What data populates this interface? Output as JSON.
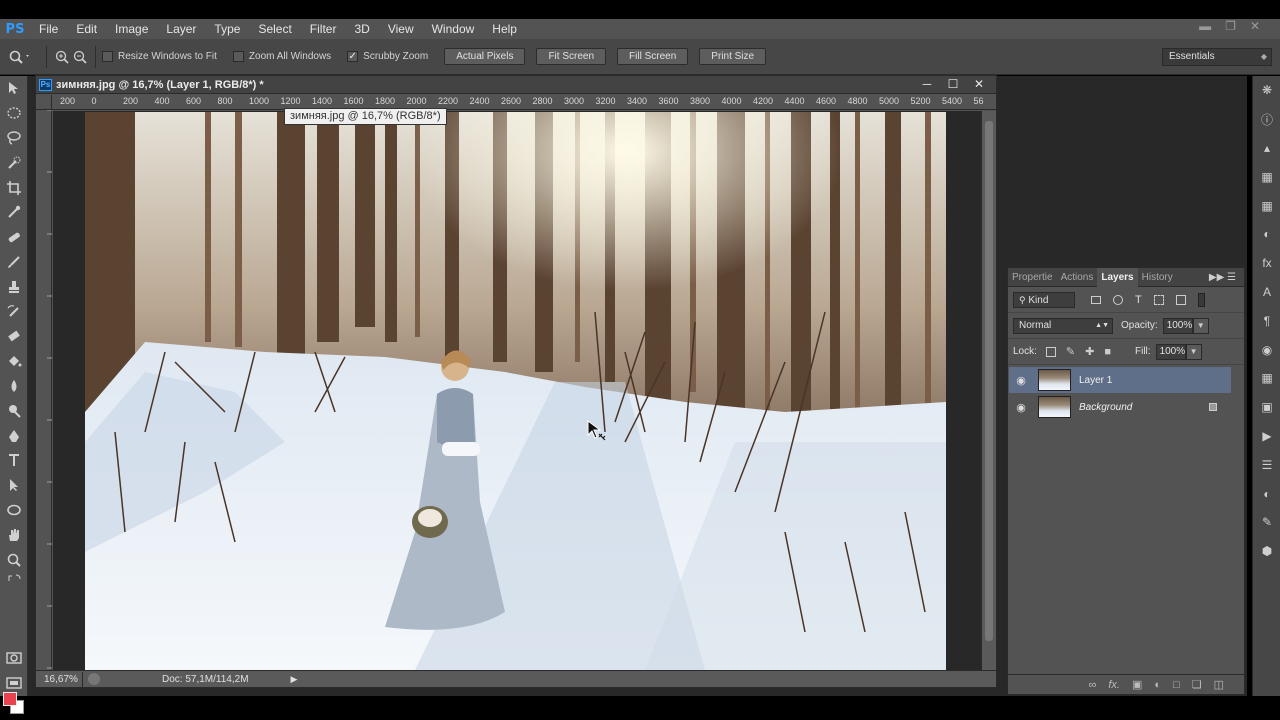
{
  "app": {
    "logo": "PS"
  },
  "menu": [
    "File",
    "Edit",
    "Image",
    "Layer",
    "Type",
    "Select",
    "Filter",
    "3D",
    "View",
    "Window",
    "Help"
  ],
  "options": {
    "resize_windows": "Resize Windows to Fit",
    "zoom_all": "Zoom All Windows",
    "scrubby_zoom": "Scrubby Zoom",
    "actual_pixels": "Actual Pixels",
    "fit_screen": "Fit Screen",
    "fill_screen": "Fill Screen",
    "print_size": "Print Size",
    "workspace": "Essentials"
  },
  "document": {
    "title": "зимняя.jpg @ 16,7% (Layer 1, RGB/8*) *",
    "tooltip": "зимняя.jpg @ 16,7% (RGB/8*)",
    "zoom": "16,67%",
    "doc_size": "Doc: 57,1M/114,2M"
  },
  "ruler_top": [
    "200",
    "0",
    "200",
    "400",
    "600",
    "800",
    "1000",
    "1200",
    "1400",
    "1600",
    "1800",
    "2000",
    "2200",
    "2400",
    "2600",
    "2800",
    "3000",
    "3200",
    "3400",
    "3600",
    "3800",
    "4000",
    "4200",
    "4400",
    "4600",
    "4800",
    "5000",
    "5200",
    "5400",
    "56"
  ],
  "panel": {
    "tabs": [
      "Propertie",
      "Actions",
      "Layers",
      "History"
    ],
    "active_tab": "Layers",
    "kind": "Kind",
    "blend_mode": "Normal",
    "opacity_label": "Opacity:",
    "opacity": "100%",
    "lock_label": "Lock:",
    "fill_label": "Fill:",
    "fill": "100%",
    "layers": [
      {
        "name": "Layer 1",
        "selected": true
      },
      {
        "name": "Background",
        "selected": false,
        "locked": true
      }
    ]
  },
  "colors": {
    "foreground": "#e8434f",
    "background": "#ffffff",
    "selection": "#5f6e89"
  }
}
